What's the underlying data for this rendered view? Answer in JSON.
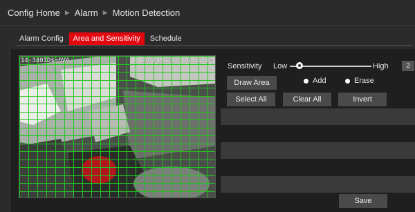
{
  "breadcrumb": {
    "home": "Config Home",
    "section": "Alarm",
    "page": "Motion Detection"
  },
  "tabs": [
    {
      "label": "Alarm Config"
    },
    {
      "label": "Area and Sensitivity"
    },
    {
      "label": "Schedule"
    }
  ],
  "video": {
    "osd_left": "14-340ID$=0VA",
    "osd_right": "28/01/2020 16:25:24"
  },
  "sensitivity": {
    "label": "Sensitivity",
    "low": "Low",
    "high": "High",
    "value": "2",
    "level": 0.12
  },
  "area": {
    "draw_area": "Draw Area",
    "add": "Add",
    "erase": "Erase",
    "select_all": "Select All",
    "clear_all": "Clear All",
    "invert": "Invert"
  },
  "save_label": "Save",
  "colors": {
    "accent": "#e3070f",
    "grid": "#22c61f"
  }
}
